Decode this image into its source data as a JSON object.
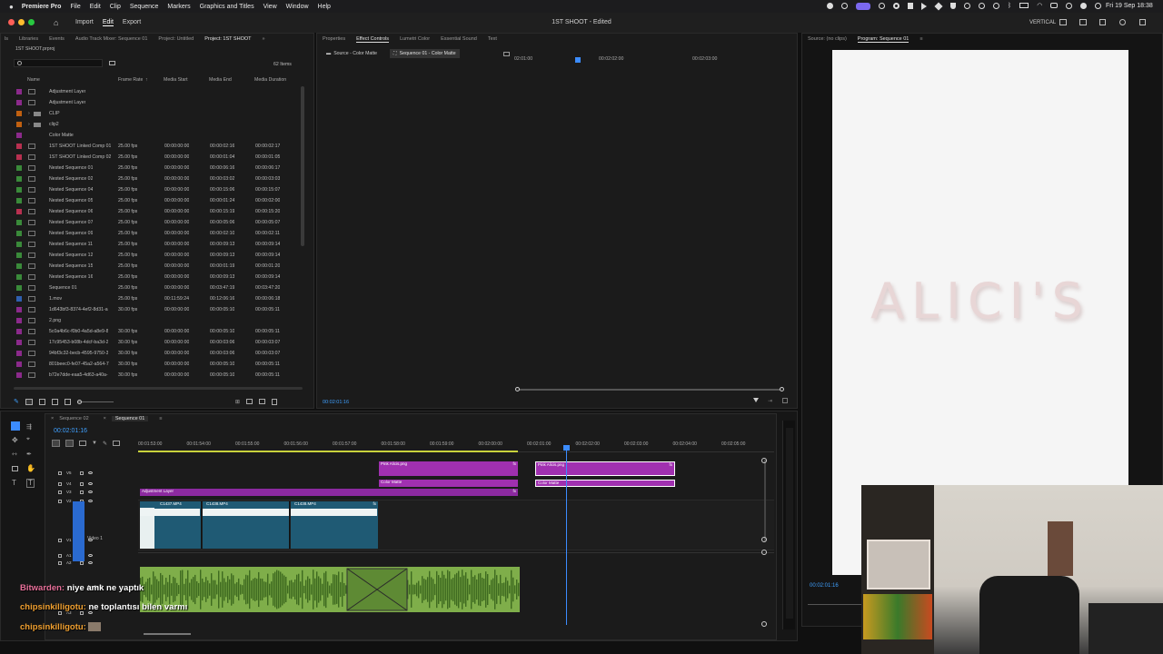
{
  "menubar": {
    "app_name": "Premiere Pro",
    "items": [
      "File",
      "Edit",
      "Clip",
      "Sequence",
      "Markers",
      "Graphics and Titles",
      "View",
      "Window",
      "Help"
    ],
    "clock": "Fri 19 Sep 18:38"
  },
  "titlebar": {
    "nav": [
      "Import",
      "Edit",
      "Export"
    ],
    "active_nav": "Edit",
    "title": "1ST SHOOT - Edited",
    "workspace": "VERTICAL"
  },
  "project_panel": {
    "tabs": [
      "Libraries",
      "Events",
      "Audio Track Mixer: Sequence 01",
      "Project: Untitled",
      "Project: 1ST SHOOT"
    ],
    "active_tab": "Project: 1ST SHOOT",
    "project_file": "1ST SHOOT.prproj",
    "item_count": "62 Items",
    "columns": [
      "Name",
      "Frame Rate",
      "Media Start",
      "Media End",
      "Media Duration"
    ],
    "rows": [
      {
        "name": "Adjustment Layer",
        "fps": "",
        "start": "",
        "end": "",
        "dur": "",
        "color": "#8b2a8b",
        "icon": "adj"
      },
      {
        "name": "Adjustment Layer",
        "fps": "",
        "start": "",
        "end": "",
        "dur": "",
        "color": "#8b2a8b",
        "icon": "adj"
      },
      {
        "name": "CLIP",
        "fps": "",
        "start": "",
        "end": "",
        "dur": "",
        "color": "#c06010",
        "icon": "bin"
      },
      {
        "name": "clip2",
        "fps": "",
        "start": "",
        "end": "",
        "dur": "",
        "color": "#c06010",
        "icon": "bin"
      },
      {
        "name": "Color Matte",
        "fps": "",
        "start": "",
        "end": "",
        "dur": "",
        "color": "#8b2a8b",
        "icon": "none"
      },
      {
        "name": "1ST SHOOT Linked Comp 01",
        "fps": "25.00 fps",
        "start": "00:00:00:00",
        "end": "00:00:02:16",
        "dur": "00:00:02:17",
        "color": "#b83050",
        "icon": "comp"
      },
      {
        "name": "1ST SHOOT Linked Comp 02",
        "fps": "25.00 fps",
        "start": "00:00:00:00",
        "end": "00:00:01:04",
        "dur": "00:00:01:05",
        "color": "#b83050",
        "icon": "comp"
      },
      {
        "name": "Nested Sequence 01",
        "fps": "25.00 fps",
        "start": "00:00:00:00",
        "end": "00:00:06:16",
        "dur": "00:00:06:17",
        "color": "#3a8a3a",
        "icon": "seq"
      },
      {
        "name": "Nested Sequence 02",
        "fps": "25.00 fps",
        "start": "00:00:00:00",
        "end": "00:00:03:02",
        "dur": "00:00:03:03",
        "color": "#3a8a3a",
        "icon": "seq"
      },
      {
        "name": "Nested Sequence 04",
        "fps": "25.00 fps",
        "start": "00:00:00:00",
        "end": "00:00:15:06",
        "dur": "00:00:15:07",
        "color": "#3a8a3a",
        "icon": "seq"
      },
      {
        "name": "Nested Sequence 05",
        "fps": "25.00 fps",
        "start": "00:00:00:00",
        "end": "00:00:01:24",
        "dur": "00:00:02:00",
        "color": "#3a8a3a",
        "icon": "seq"
      },
      {
        "name": "Nested Sequence 06",
        "fps": "25.00 fps",
        "start": "00:00:00:00",
        "end": "00:00:15:19",
        "dur": "00:00:15:20",
        "color": "#b83050",
        "icon": "seq"
      },
      {
        "name": "Nested Sequence 07",
        "fps": "25.00 fps",
        "start": "00:00:00:00",
        "end": "00:00:05:06",
        "dur": "00:00:05:07",
        "color": "#3a8a3a",
        "icon": "seq"
      },
      {
        "name": "Nested Sequence 09",
        "fps": "25.00 fps",
        "start": "00:00:00:00",
        "end": "00:00:02:10",
        "dur": "00:00:02:11",
        "color": "#3a8a3a",
        "icon": "seq"
      },
      {
        "name": "Nested Sequence 11",
        "fps": "25.00 fps",
        "start": "00:00:00:00",
        "end": "00:00:09:13",
        "dur": "00:00:09:14",
        "color": "#3a8a3a",
        "icon": "seq"
      },
      {
        "name": "Nested Sequence 12",
        "fps": "25.00 fps",
        "start": "00:00:00:00",
        "end": "00:00:09:13",
        "dur": "00:00:09:14",
        "color": "#3a8a3a",
        "icon": "seq"
      },
      {
        "name": "Nested Sequence 15",
        "fps": "25.00 fps",
        "start": "00:00:00:00",
        "end": "00:00:01:19",
        "dur": "00:00:01:20",
        "color": "#3a8a3a",
        "icon": "seq"
      },
      {
        "name": "Nested Sequence 16",
        "fps": "25.00 fps",
        "start": "00:00:00:00",
        "end": "00:00:09:13",
        "dur": "00:00:09:14",
        "color": "#3a8a3a",
        "icon": "seq"
      },
      {
        "name": "Sequence 01",
        "fps": "25.00 fps",
        "start": "00:00:00:00",
        "end": "00:03:47:19",
        "dur": "00:03:47:20",
        "color": "#3a8a3a",
        "icon": "seq"
      },
      {
        "name": "1.mov",
        "fps": "25.00 fps",
        "start": "00:11:59:24",
        "end": "00:12:06:16",
        "dur": "00:00:06:18",
        "color": "#3060b0",
        "icon": "vid"
      },
      {
        "name": "1d643bf3-8374-4ef2-8d31-a",
        "fps": "30.00 fps",
        "start": "00:00:00:00",
        "end": "00:00:05:10",
        "dur": "00:00:05:11",
        "color": "#8b2a8b",
        "icon": "vid"
      },
      {
        "name": "2.png",
        "fps": "",
        "start": "",
        "end": "",
        "dur": "",
        "color": "#8b2a8b",
        "icon": "img"
      },
      {
        "name": "5c0a4b6c-f0b0-4a5d-a8e9-8",
        "fps": "30.00 fps",
        "start": "00:00:00:00",
        "end": "00:00:05:10",
        "dur": "00:00:05:11",
        "color": "#8b2a8b",
        "icon": "vid"
      },
      {
        "name": "17c95453-b08b-4dcf-ba3d-2",
        "fps": "30.00 fps",
        "start": "00:00:00:00",
        "end": "00:00:03:06",
        "dur": "00:00:03:07",
        "color": "#8b2a8b",
        "icon": "vid"
      },
      {
        "name": "94bf3c32-becb-4595-9750-3",
        "fps": "30.00 fps",
        "start": "00:00:00:00",
        "end": "00:00:03:06",
        "dur": "00:00:03:07",
        "color": "#8b2a8b",
        "icon": "vid"
      },
      {
        "name": "801beec0-fe07-45a2-a564-7",
        "fps": "30.00 fps",
        "start": "00:00:00:00",
        "end": "00:00:05:10",
        "dur": "00:00:05:11",
        "color": "#8b2a8b",
        "icon": "vid"
      },
      {
        "name": "b72e7dde-eaa5-4d63-a40a-",
        "fps": "30.00 fps",
        "start": "00:00:00:00",
        "end": "00:00:05:10",
        "dur": "00:00:05:11",
        "color": "#8b2a8b",
        "icon": "vid"
      }
    ]
  },
  "effect_controls": {
    "tabs": [
      "Properties",
      "Effect Controls",
      "Lumetri Color",
      "Essential Sound",
      "Text"
    ],
    "active_tab": "Effect Controls",
    "source_tab": "Source - Color Matte",
    "seq_tab": "Sequence 01 - Color Matte",
    "ruler": [
      "02:01:00",
      "00:02:02:00",
      "00:02:03:00"
    ],
    "timecode": "00:02:01:16"
  },
  "program_monitor": {
    "tabs": [
      "Source: (no clips)",
      "Program: Sequence 01"
    ],
    "active_tab": "Program: Sequence 01",
    "logo_text": "ALICI'S",
    "timecode": "00:02:01:16"
  },
  "timeline": {
    "tabs": [
      "Sequence 02",
      "Sequence 01"
    ],
    "active_tab": "Sequence 01",
    "timecode": "00:02:01:16",
    "ruler": [
      "00:01:53:00",
      "00:01:54:00",
      "00:01:55:00",
      "00:01:56:00",
      "00:01:57:00",
      "00:01:58:00",
      "00:01:59:00",
      "00:02:00:00",
      "00:02:01:00",
      "00:02:02:00",
      "00:02:03:00",
      "00:02:04:00",
      "00:02:05:00"
    ],
    "tracks": [
      "V5",
      "V4",
      "V3",
      "V2",
      "V1",
      "A1",
      "A2",
      "A3"
    ],
    "video1_label": "Video 1",
    "audio3_label": "Audio 3",
    "clips": {
      "pink1": "Pink Alicis.png",
      "pink2": "Pink Alicis.png",
      "matte1": "Color Matte",
      "matte2": "Color Matte",
      "adjustment": "Adjustment Layer",
      "v1a": "C1437.MP4",
      "v1b": "C1438.MP4",
      "v1c": "C1438.MP4"
    }
  },
  "chat": [
    {
      "user": "Bitwarden:",
      "message": "niye amk ne yaptık",
      "color": "#e8709a"
    },
    {
      "user": "chipsinkilligotu:",
      "message": "ne toplantısı bilen varmı",
      "color": "#f0a030"
    },
    {
      "user": "chipsinkilligotu:",
      "message": "",
      "color": "#f0a030"
    }
  ]
}
